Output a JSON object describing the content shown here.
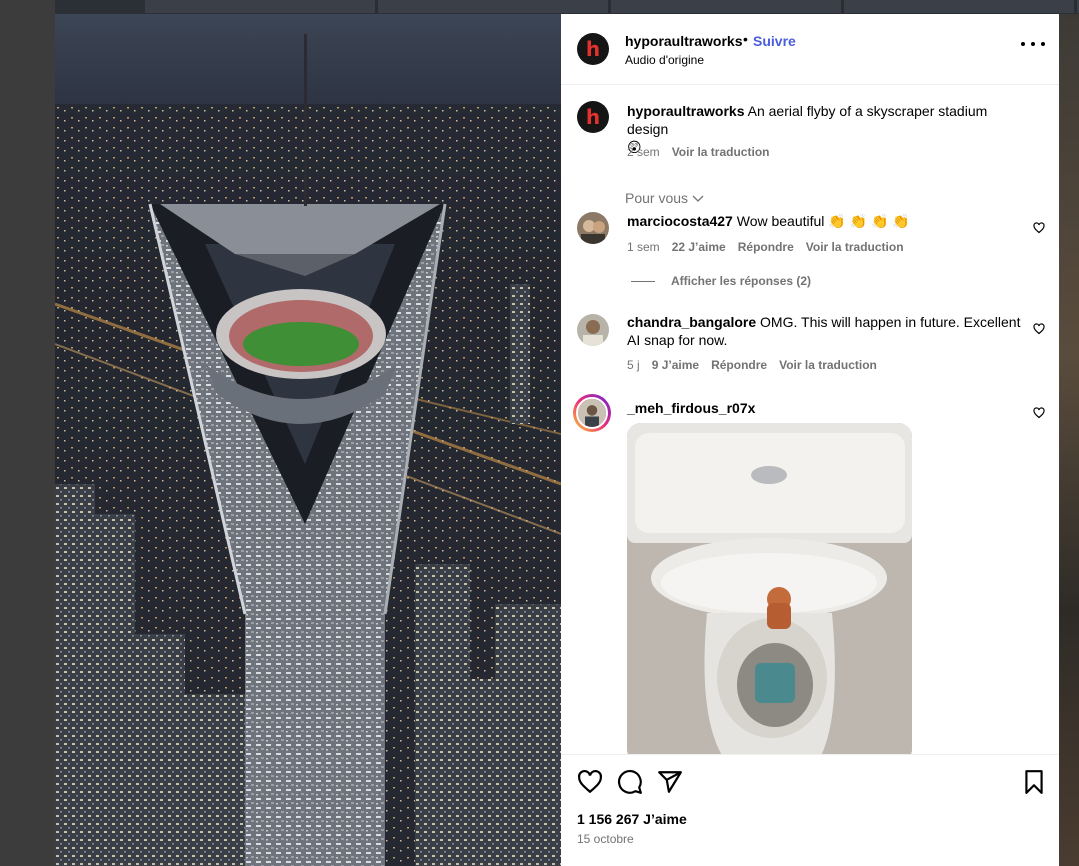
{
  "post": {
    "username": "hyporaultraworks",
    "follow_label": "Suivre",
    "separator": "•",
    "audio_label": "Audio d'origine",
    "caption": "An aerial flyby of a skyscraper stadium design",
    "caption_emoji": "😲",
    "caption_time": "2 sem",
    "caption_translate": "Voir la traduction",
    "pour_vous": "Pour vous",
    "likes": "1 156 267 J’aime",
    "date": "15 octobre"
  },
  "comments": [
    {
      "username": "marciocosta427",
      "text": "Wow beautiful 👏 👏 👏 👏",
      "time": "1 sem",
      "likes": "22 J’aime",
      "reply": "Répondre",
      "translate": "Voir la traduction",
      "view_replies": "Afficher les réponses (2)"
    },
    {
      "username": "chandra_bangalore",
      "text": "OMG. This will happen in future. Excellent AI snap for now.",
      "time": "5 j",
      "likes": "9 J’aime",
      "reply": "Répondre",
      "translate": "Voir la traduction"
    },
    {
      "username": "_meh_firdous_r07x",
      "text": ""
    }
  ],
  "icons": {
    "header_more": "more-horizontal-icon",
    "like": "heart-icon",
    "comment": "comment-bubble-icon",
    "share": "paper-plane-icon",
    "save": "bookmark-icon"
  },
  "colors": {
    "follow": "#4a5ddf",
    "meta_text": "#737373",
    "logo_red": "#e2322d"
  }
}
